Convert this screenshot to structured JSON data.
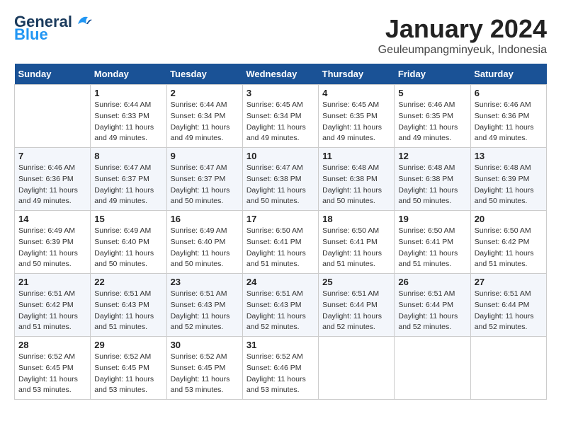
{
  "header": {
    "logo_line1": "General",
    "logo_line2": "Blue",
    "title": "January 2024",
    "subtitle": "Geuleumpangminyeuk, Indonesia"
  },
  "weekdays": [
    "Sunday",
    "Monday",
    "Tuesday",
    "Wednesday",
    "Thursday",
    "Friday",
    "Saturday"
  ],
  "weeks": [
    [
      {
        "day": "",
        "info": ""
      },
      {
        "day": "1",
        "info": "Sunrise: 6:44 AM\nSunset: 6:33 PM\nDaylight: 11 hours\nand 49 minutes."
      },
      {
        "day": "2",
        "info": "Sunrise: 6:44 AM\nSunset: 6:34 PM\nDaylight: 11 hours\nand 49 minutes."
      },
      {
        "day": "3",
        "info": "Sunrise: 6:45 AM\nSunset: 6:34 PM\nDaylight: 11 hours\nand 49 minutes."
      },
      {
        "day": "4",
        "info": "Sunrise: 6:45 AM\nSunset: 6:35 PM\nDaylight: 11 hours\nand 49 minutes."
      },
      {
        "day": "5",
        "info": "Sunrise: 6:46 AM\nSunset: 6:35 PM\nDaylight: 11 hours\nand 49 minutes."
      },
      {
        "day": "6",
        "info": "Sunrise: 6:46 AM\nSunset: 6:36 PM\nDaylight: 11 hours\nand 49 minutes."
      }
    ],
    [
      {
        "day": "7",
        "info": "Sunrise: 6:46 AM\nSunset: 6:36 PM\nDaylight: 11 hours\nand 49 minutes."
      },
      {
        "day": "8",
        "info": "Sunrise: 6:47 AM\nSunset: 6:37 PM\nDaylight: 11 hours\nand 49 minutes."
      },
      {
        "day": "9",
        "info": "Sunrise: 6:47 AM\nSunset: 6:37 PM\nDaylight: 11 hours\nand 50 minutes."
      },
      {
        "day": "10",
        "info": "Sunrise: 6:47 AM\nSunset: 6:38 PM\nDaylight: 11 hours\nand 50 minutes."
      },
      {
        "day": "11",
        "info": "Sunrise: 6:48 AM\nSunset: 6:38 PM\nDaylight: 11 hours\nand 50 minutes."
      },
      {
        "day": "12",
        "info": "Sunrise: 6:48 AM\nSunset: 6:38 PM\nDaylight: 11 hours\nand 50 minutes."
      },
      {
        "day": "13",
        "info": "Sunrise: 6:48 AM\nSunset: 6:39 PM\nDaylight: 11 hours\nand 50 minutes."
      }
    ],
    [
      {
        "day": "14",
        "info": "Sunrise: 6:49 AM\nSunset: 6:39 PM\nDaylight: 11 hours\nand 50 minutes."
      },
      {
        "day": "15",
        "info": "Sunrise: 6:49 AM\nSunset: 6:40 PM\nDaylight: 11 hours\nand 50 minutes."
      },
      {
        "day": "16",
        "info": "Sunrise: 6:49 AM\nSunset: 6:40 PM\nDaylight: 11 hours\nand 50 minutes."
      },
      {
        "day": "17",
        "info": "Sunrise: 6:50 AM\nSunset: 6:41 PM\nDaylight: 11 hours\nand 51 minutes."
      },
      {
        "day": "18",
        "info": "Sunrise: 6:50 AM\nSunset: 6:41 PM\nDaylight: 11 hours\nand 51 minutes."
      },
      {
        "day": "19",
        "info": "Sunrise: 6:50 AM\nSunset: 6:41 PM\nDaylight: 11 hours\nand 51 minutes."
      },
      {
        "day": "20",
        "info": "Sunrise: 6:50 AM\nSunset: 6:42 PM\nDaylight: 11 hours\nand 51 minutes."
      }
    ],
    [
      {
        "day": "21",
        "info": "Sunrise: 6:51 AM\nSunset: 6:42 PM\nDaylight: 11 hours\nand 51 minutes."
      },
      {
        "day": "22",
        "info": "Sunrise: 6:51 AM\nSunset: 6:43 PM\nDaylight: 11 hours\nand 51 minutes."
      },
      {
        "day": "23",
        "info": "Sunrise: 6:51 AM\nSunset: 6:43 PM\nDaylight: 11 hours\nand 52 minutes."
      },
      {
        "day": "24",
        "info": "Sunrise: 6:51 AM\nSunset: 6:43 PM\nDaylight: 11 hours\nand 52 minutes."
      },
      {
        "day": "25",
        "info": "Sunrise: 6:51 AM\nSunset: 6:44 PM\nDaylight: 11 hours\nand 52 minutes."
      },
      {
        "day": "26",
        "info": "Sunrise: 6:51 AM\nSunset: 6:44 PM\nDaylight: 11 hours\nand 52 minutes."
      },
      {
        "day": "27",
        "info": "Sunrise: 6:51 AM\nSunset: 6:44 PM\nDaylight: 11 hours\nand 52 minutes."
      }
    ],
    [
      {
        "day": "28",
        "info": "Sunrise: 6:52 AM\nSunset: 6:45 PM\nDaylight: 11 hours\nand 53 minutes."
      },
      {
        "day": "29",
        "info": "Sunrise: 6:52 AM\nSunset: 6:45 PM\nDaylight: 11 hours\nand 53 minutes."
      },
      {
        "day": "30",
        "info": "Sunrise: 6:52 AM\nSunset: 6:45 PM\nDaylight: 11 hours\nand 53 minutes."
      },
      {
        "day": "31",
        "info": "Sunrise: 6:52 AM\nSunset: 6:46 PM\nDaylight: 11 hours\nand 53 minutes."
      },
      {
        "day": "",
        "info": ""
      },
      {
        "day": "",
        "info": ""
      },
      {
        "day": "",
        "info": ""
      }
    ]
  ]
}
